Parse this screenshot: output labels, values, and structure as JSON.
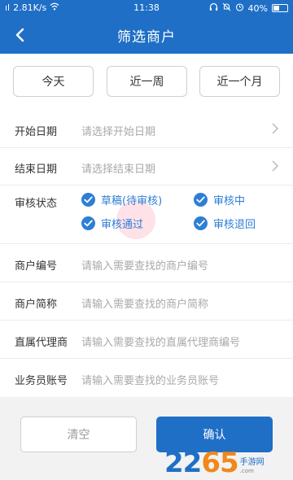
{
  "status_bar": {
    "signal": "ıl",
    "speed": "2.81K/s",
    "time": "11:38",
    "battery": "40%"
  },
  "header": {
    "title": "筛选商户"
  },
  "quick_filters": [
    {
      "label": "今天"
    },
    {
      "label": "近一周"
    },
    {
      "label": "近一个月"
    }
  ],
  "form": {
    "start_date": {
      "label": "开始日期",
      "placeholder": "请选择开始日期"
    },
    "end_date": {
      "label": "结束日期",
      "placeholder": "请选择结束日期"
    },
    "audit_status": {
      "label": "审核状态",
      "options": [
        {
          "label": "草稿(待审核)",
          "checked": true
        },
        {
          "label": "审核中",
          "checked": true
        },
        {
          "label": "审核通过",
          "checked": true
        },
        {
          "label": "审核退回",
          "checked": true
        }
      ]
    },
    "merchant_no": {
      "label": "商户编号",
      "placeholder": "请输入需要查找的商户编号"
    },
    "merchant_abbr": {
      "label": "商户简称",
      "placeholder": "请输入需要查找的商户简称"
    },
    "agent": {
      "label": "直属代理商",
      "placeholder": "请输入需要查找的直属代理商编号"
    },
    "salesman": {
      "label": "业务员账号",
      "placeholder": "请输入需要查找的业务员账号"
    }
  },
  "footer": {
    "clear_label": "清空",
    "confirm_label": "确认"
  },
  "watermark": {
    "num_a": "22",
    "num_b": "65",
    "site": "手游网",
    "domain": ".com"
  },
  "colors": {
    "primary": "#1f6fc6",
    "check": "#2e7ed6",
    "placeholder": "#a9a9a9"
  }
}
